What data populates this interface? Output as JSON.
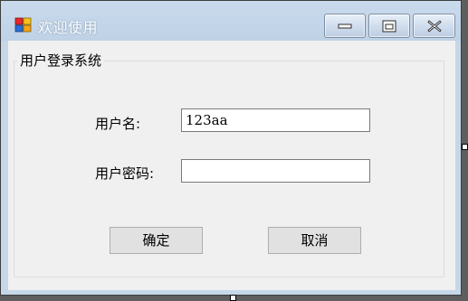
{
  "window": {
    "title": "欢迎使用"
  },
  "group": {
    "legend": "用户登录系统"
  },
  "form": {
    "username_label": "用户名:",
    "username_value": "123aa",
    "password_label": "用户密码:",
    "password_value": ""
  },
  "buttons": {
    "ok_label": "确定",
    "cancel_label": "取消"
  },
  "icons": {
    "app": "app-icon",
    "minimize": "minimize-icon",
    "maximize": "maximize-icon",
    "close": "close-icon"
  },
  "colors": {
    "titlebar": "#c6d7e9",
    "client": "#f0f0f0",
    "button": "#e1e1e1"
  }
}
